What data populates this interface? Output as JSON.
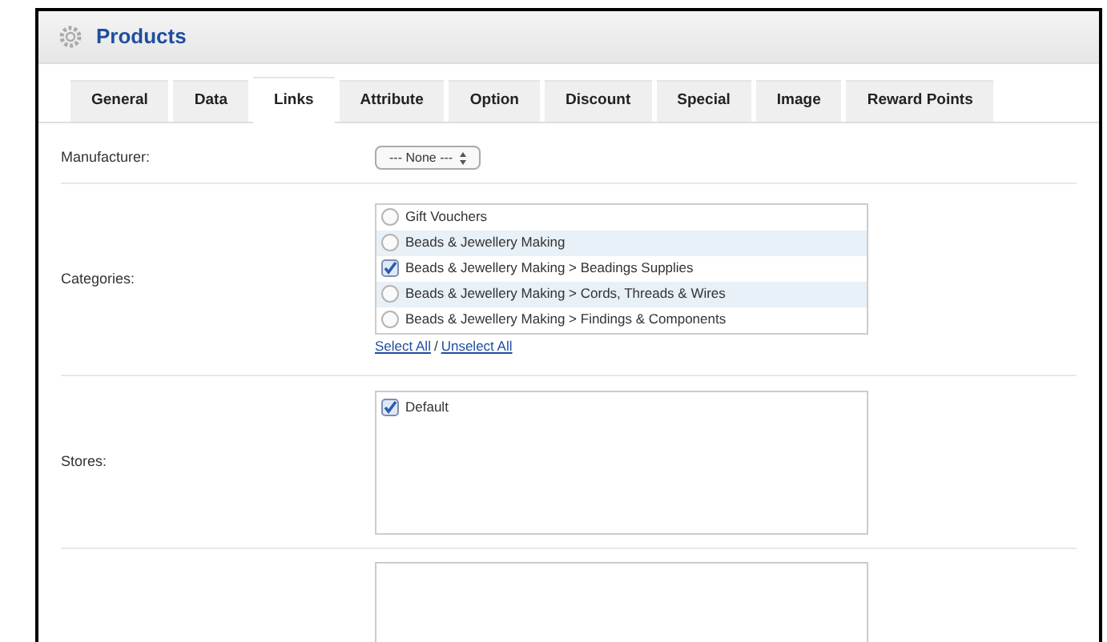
{
  "header": {
    "title": "Products"
  },
  "tabs": [
    {
      "label": "General",
      "selected": false
    },
    {
      "label": "Data",
      "selected": false
    },
    {
      "label": "Links",
      "selected": true
    },
    {
      "label": "Attribute",
      "selected": false
    },
    {
      "label": "Option",
      "selected": false
    },
    {
      "label": "Discount",
      "selected": false
    },
    {
      "label": "Special",
      "selected": false
    },
    {
      "label": "Image",
      "selected": false
    },
    {
      "label": "Reward Points",
      "selected": false
    }
  ],
  "manufacturer": {
    "label": "Manufacturer:",
    "value": "--- None ---"
  },
  "categories": {
    "label": "Categories:",
    "items": [
      {
        "label": "Gift Vouchers",
        "checked": false
      },
      {
        "label": "Beads & Jewellery Making",
        "checked": false
      },
      {
        "label": "Beads & Jewellery Making > Beadings Supplies",
        "checked": true
      },
      {
        "label": "Beads & Jewellery Making > Cords, Threads & Wires",
        "checked": false
      },
      {
        "label": "Beads & Jewellery Making > Findings & Components",
        "checked": false
      }
    ],
    "select_all": "Select All",
    "separator": "/",
    "unselect_all": "Unselect All"
  },
  "stores": {
    "label": "Stores:",
    "items": [
      {
        "label": "Default",
        "checked": true
      }
    ]
  }
}
